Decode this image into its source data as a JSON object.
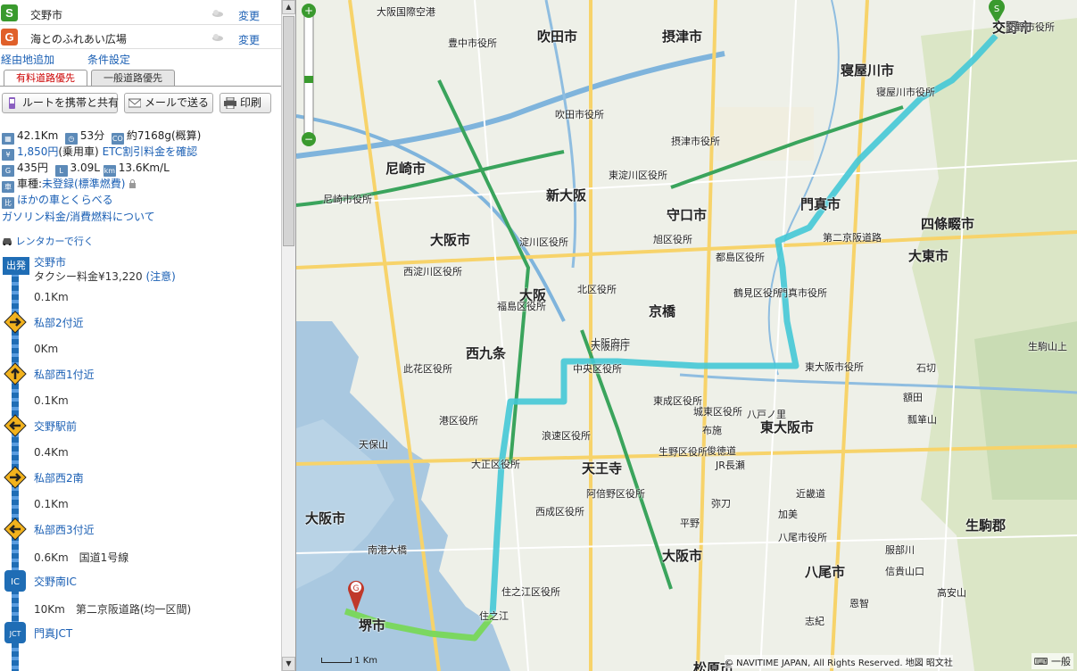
{
  "origin": {
    "badge": "S",
    "name": "交野市",
    "change_label": "変更"
  },
  "destination": {
    "badge": "G",
    "name": "海とのふれあい広場",
    "change_label": "変更"
  },
  "links": {
    "add_waypoint": "経由地追加",
    "settings": "条件設定"
  },
  "tabs": [
    {
      "label": "有料道路優先",
      "active": true
    },
    {
      "label": "一般道路優先",
      "active": false
    }
  ],
  "toolbar": {
    "share": "ルートを携帯と共有",
    "mail": "メールで送る",
    "print": "印刷"
  },
  "summary": {
    "distance": "42.1Km",
    "time": "53分",
    "co2": "約7168g(概算)",
    "fare": "1,850円",
    "fare_type": "(乗用車)",
    "etc_link": "ETC割引料金を確認",
    "fuel_cost": "435円",
    "fuel_liters": "3.09L",
    "fuel_eff": "13.6Km/L",
    "vehicle_label": "車種:",
    "vehicle_value": "未登録(標準燃費)",
    "compare_link": "ほかの車とくらべる",
    "gas_link": "ガソリン料金/消費燃料について"
  },
  "rental_link": "レンタカーで行く",
  "start_block": {
    "label": "出発",
    "name": "交野市",
    "taxi_prefix": "タクシー料金¥13,220",
    "taxi_note": "(注意)"
  },
  "steps": [
    {
      "dist": "0.1Km",
      "title": "私部2付近",
      "dir": "right",
      "extra": ""
    },
    {
      "dist": "0Km",
      "title": "私部西1付近",
      "dir": "up",
      "extra": ""
    },
    {
      "dist": "0.1Km",
      "title": "交野駅前",
      "dir": "left",
      "extra": ""
    },
    {
      "dist": "0.4Km",
      "title": "私部西2南",
      "dir": "right",
      "extra": ""
    },
    {
      "dist": "0.1Km",
      "title": "私部西3付近",
      "dir": "left",
      "extra": ""
    },
    {
      "dist": "0.6Km",
      "title": "交野南IC",
      "dir": "ic",
      "extra": "国道1号線"
    },
    {
      "dist": "10Km",
      "title": "門真JCT",
      "dir": "jct",
      "extra": "第二京阪道路(均一区間)"
    }
  ],
  "map": {
    "scale": "1 Km",
    "copyright": "© NAVITIME JAPAN, All Rights Reserved. 地図 昭文社",
    "tools": "一般",
    "labels": [
      "大阪国際空港",
      "吹田市",
      "摂津市",
      "寝屋川市",
      "交野市",
      "豊中市役所",
      "吹田市役所",
      "摂津市役所",
      "尼崎市",
      "新大阪",
      "大阪市",
      "守口市",
      "門真市",
      "四條畷市",
      "大東市",
      "大阪",
      "京橋",
      "大阪府庁",
      "西九条",
      "天王寺",
      "東大阪市",
      "生駒郡",
      "八尾市",
      "大阪市",
      "松原市",
      "堺市",
      "大阪市",
      "天保山",
      "南港大橋",
      "住之江",
      "東大阪市役所",
      "門真市役所",
      "寝屋川市役所",
      "交野市役所",
      "第二京阪道路",
      "近畿道",
      "大阪府庁",
      "阿倍野区役所",
      "住之江区役所",
      "浪速区役所",
      "中央区役所",
      "港区役所",
      "大正区役所",
      "西成区役所",
      "東成区役所",
      "生野区役所",
      "城東区役所",
      "鶴見区役所",
      "都島区役所",
      "旭区役所",
      "北区役所",
      "福島区役所",
      "此花区役所",
      "西淀川区役所",
      "淀川区役所",
      "東淀川区役所",
      "尼崎市役所",
      "八尾市役所",
      "生駒山上",
      "信貴山口",
      "石切",
      "額田",
      "瓢箪山",
      "八戸ノ里",
      "布施",
      "俊徳道",
      "平野",
      "加美",
      "志紀",
      "恩智",
      "服部川",
      "高安山",
      "JR長瀬",
      "弥刀"
    ]
  },
  "colors": {
    "route": "#44c8d6",
    "route_end": "#78d858",
    "link": "#1a5fb4",
    "water": "#a9c8e0",
    "green": "#c9dcb4"
  }
}
